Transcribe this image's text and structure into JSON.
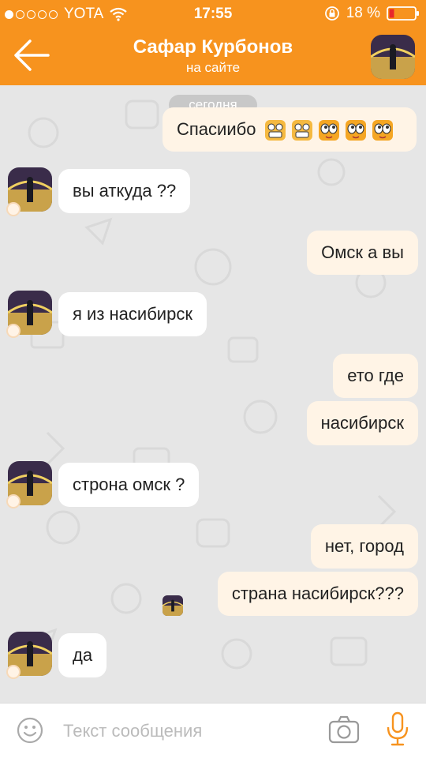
{
  "status_bar": {
    "carrier": "YOTA",
    "time": "17:55",
    "battery": "18 %",
    "signal_bars_filled": 1,
    "signal_bars_total": 5
  },
  "header": {
    "contact_name": "Сафар Курбонов",
    "contact_status": "на сайте",
    "back_icon": "arrow-left-icon",
    "color": "#f7931e"
  },
  "chat": {
    "date_separator": "сегодня",
    "messages": [
      {
        "direction": "out",
        "text": "Спасиибо",
        "emojis": [
          "grin-emoji-icon",
          "grin-emoji-icon",
          "googly-eyes-emoji-icon",
          "googly-eyes-emoji-icon",
          "googly-eyes-emoji-icon"
        ]
      },
      {
        "direction": "in",
        "text": "вы аткуда ??"
      },
      {
        "direction": "out",
        "text": "Омск а вы"
      },
      {
        "direction": "in",
        "text": "я из насибирск"
      },
      {
        "direction": "out",
        "text": "ето где"
      },
      {
        "direction": "out",
        "text": "насибирск"
      },
      {
        "direction": "in",
        "text": "строна омск ?"
      },
      {
        "direction": "out",
        "text": "нет, город"
      },
      {
        "direction": "out",
        "text": "страна насибирск???"
      },
      {
        "direction": "in",
        "text": "да"
      }
    ],
    "colors": {
      "incoming_bubble": "#ffffff",
      "outgoing_bubble": "#fff4e6",
      "background": "#e6e6e6"
    }
  },
  "input_bar": {
    "placeholder": "Текст сообщения",
    "value": "",
    "smiley_icon": "smiley-icon",
    "camera_icon": "camera-icon",
    "mic_icon": "microphone-icon",
    "accent": "#f7931e"
  }
}
